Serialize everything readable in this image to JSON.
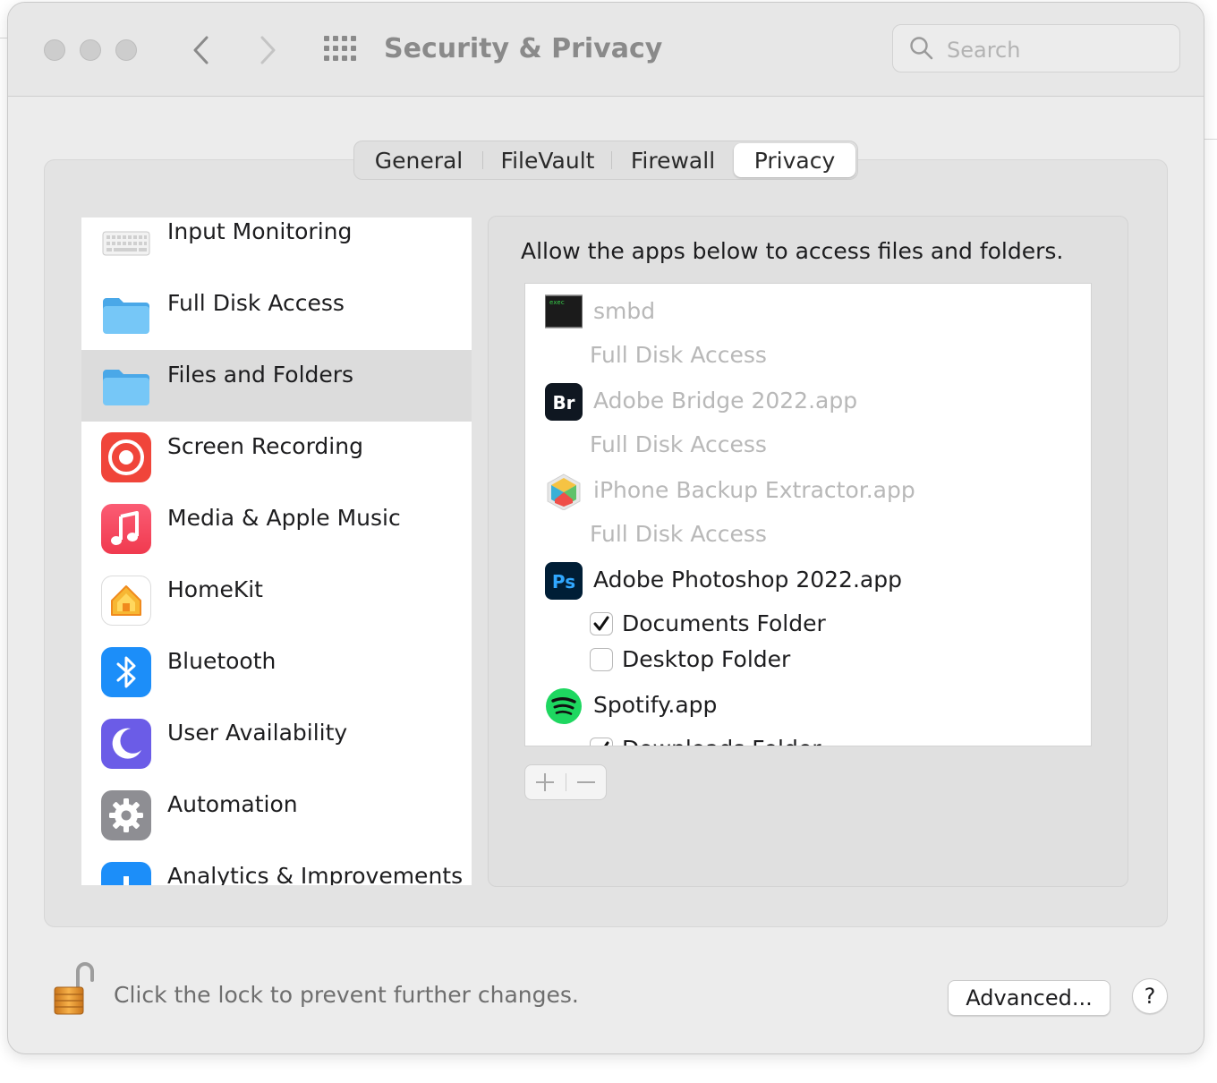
{
  "window": {
    "title": "Security & Privacy",
    "search_placeholder": "Search"
  },
  "tabs": [
    {
      "label": "General",
      "active": false
    },
    {
      "label": "FileVault",
      "active": false
    },
    {
      "label": "Firewall",
      "active": false
    },
    {
      "label": "Privacy",
      "active": true
    }
  ],
  "sidebar": {
    "selected": "Files and Folders",
    "items": [
      {
        "label": "Input Monitoring",
        "icon": "keyboard-icon"
      },
      {
        "label": "Full Disk Access",
        "icon": "folder-icon"
      },
      {
        "label": "Files and Folders",
        "icon": "folder-icon"
      },
      {
        "label": "Screen Recording",
        "icon": "screen-recording-icon"
      },
      {
        "label": "Media & Apple Music",
        "icon": "music-note-icon"
      },
      {
        "label": "HomeKit",
        "icon": "home-icon"
      },
      {
        "label": "Bluetooth",
        "icon": "bluetooth-icon"
      },
      {
        "label": "User Availability",
        "icon": "moon-icon"
      },
      {
        "label": "Automation",
        "icon": "gear-icon"
      },
      {
        "label": "Analytics & Improvements",
        "icon": "analytics-icon"
      }
    ]
  },
  "content": {
    "description": "Allow the apps below to access files and folders.",
    "apps": [
      {
        "name": "smbd",
        "icon": "terminal-exec-icon",
        "icon_text": "exec",
        "dimmed": true,
        "note": "Full Disk Access"
      },
      {
        "name": "Adobe Bridge 2022.app",
        "icon": "adobe-bridge-icon",
        "icon_text": "Br",
        "dimmed": true,
        "note": "Full Disk Access"
      },
      {
        "name": "iPhone Backup Extractor.app",
        "icon": "iphone-backup-extractor-icon",
        "dimmed": true,
        "note": "Full Disk Access"
      },
      {
        "name": "Adobe Photoshop 2022.app",
        "icon": "adobe-photoshop-icon",
        "icon_text": "Ps",
        "dimmed": false,
        "permissions": [
          {
            "label": "Documents Folder",
            "checked": true
          },
          {
            "label": "Desktop Folder",
            "checked": false
          }
        ]
      },
      {
        "name": "Spotify.app",
        "icon": "spotify-icon",
        "dimmed": false,
        "permissions": [
          {
            "label": "Downloads Folder",
            "checked": true
          }
        ]
      }
    ]
  },
  "footer": {
    "lock_text": "Click the lock to prevent further changes.",
    "advanced_label": "Advanced...",
    "help_label": "?"
  },
  "colors": {
    "window_bg": "#ececec",
    "sidebar_selected": "#dcdcdc",
    "folder_blue": "#6cc3f5",
    "photoshop_blue": "#31a8ff",
    "spotify_green": "#1ed760"
  }
}
